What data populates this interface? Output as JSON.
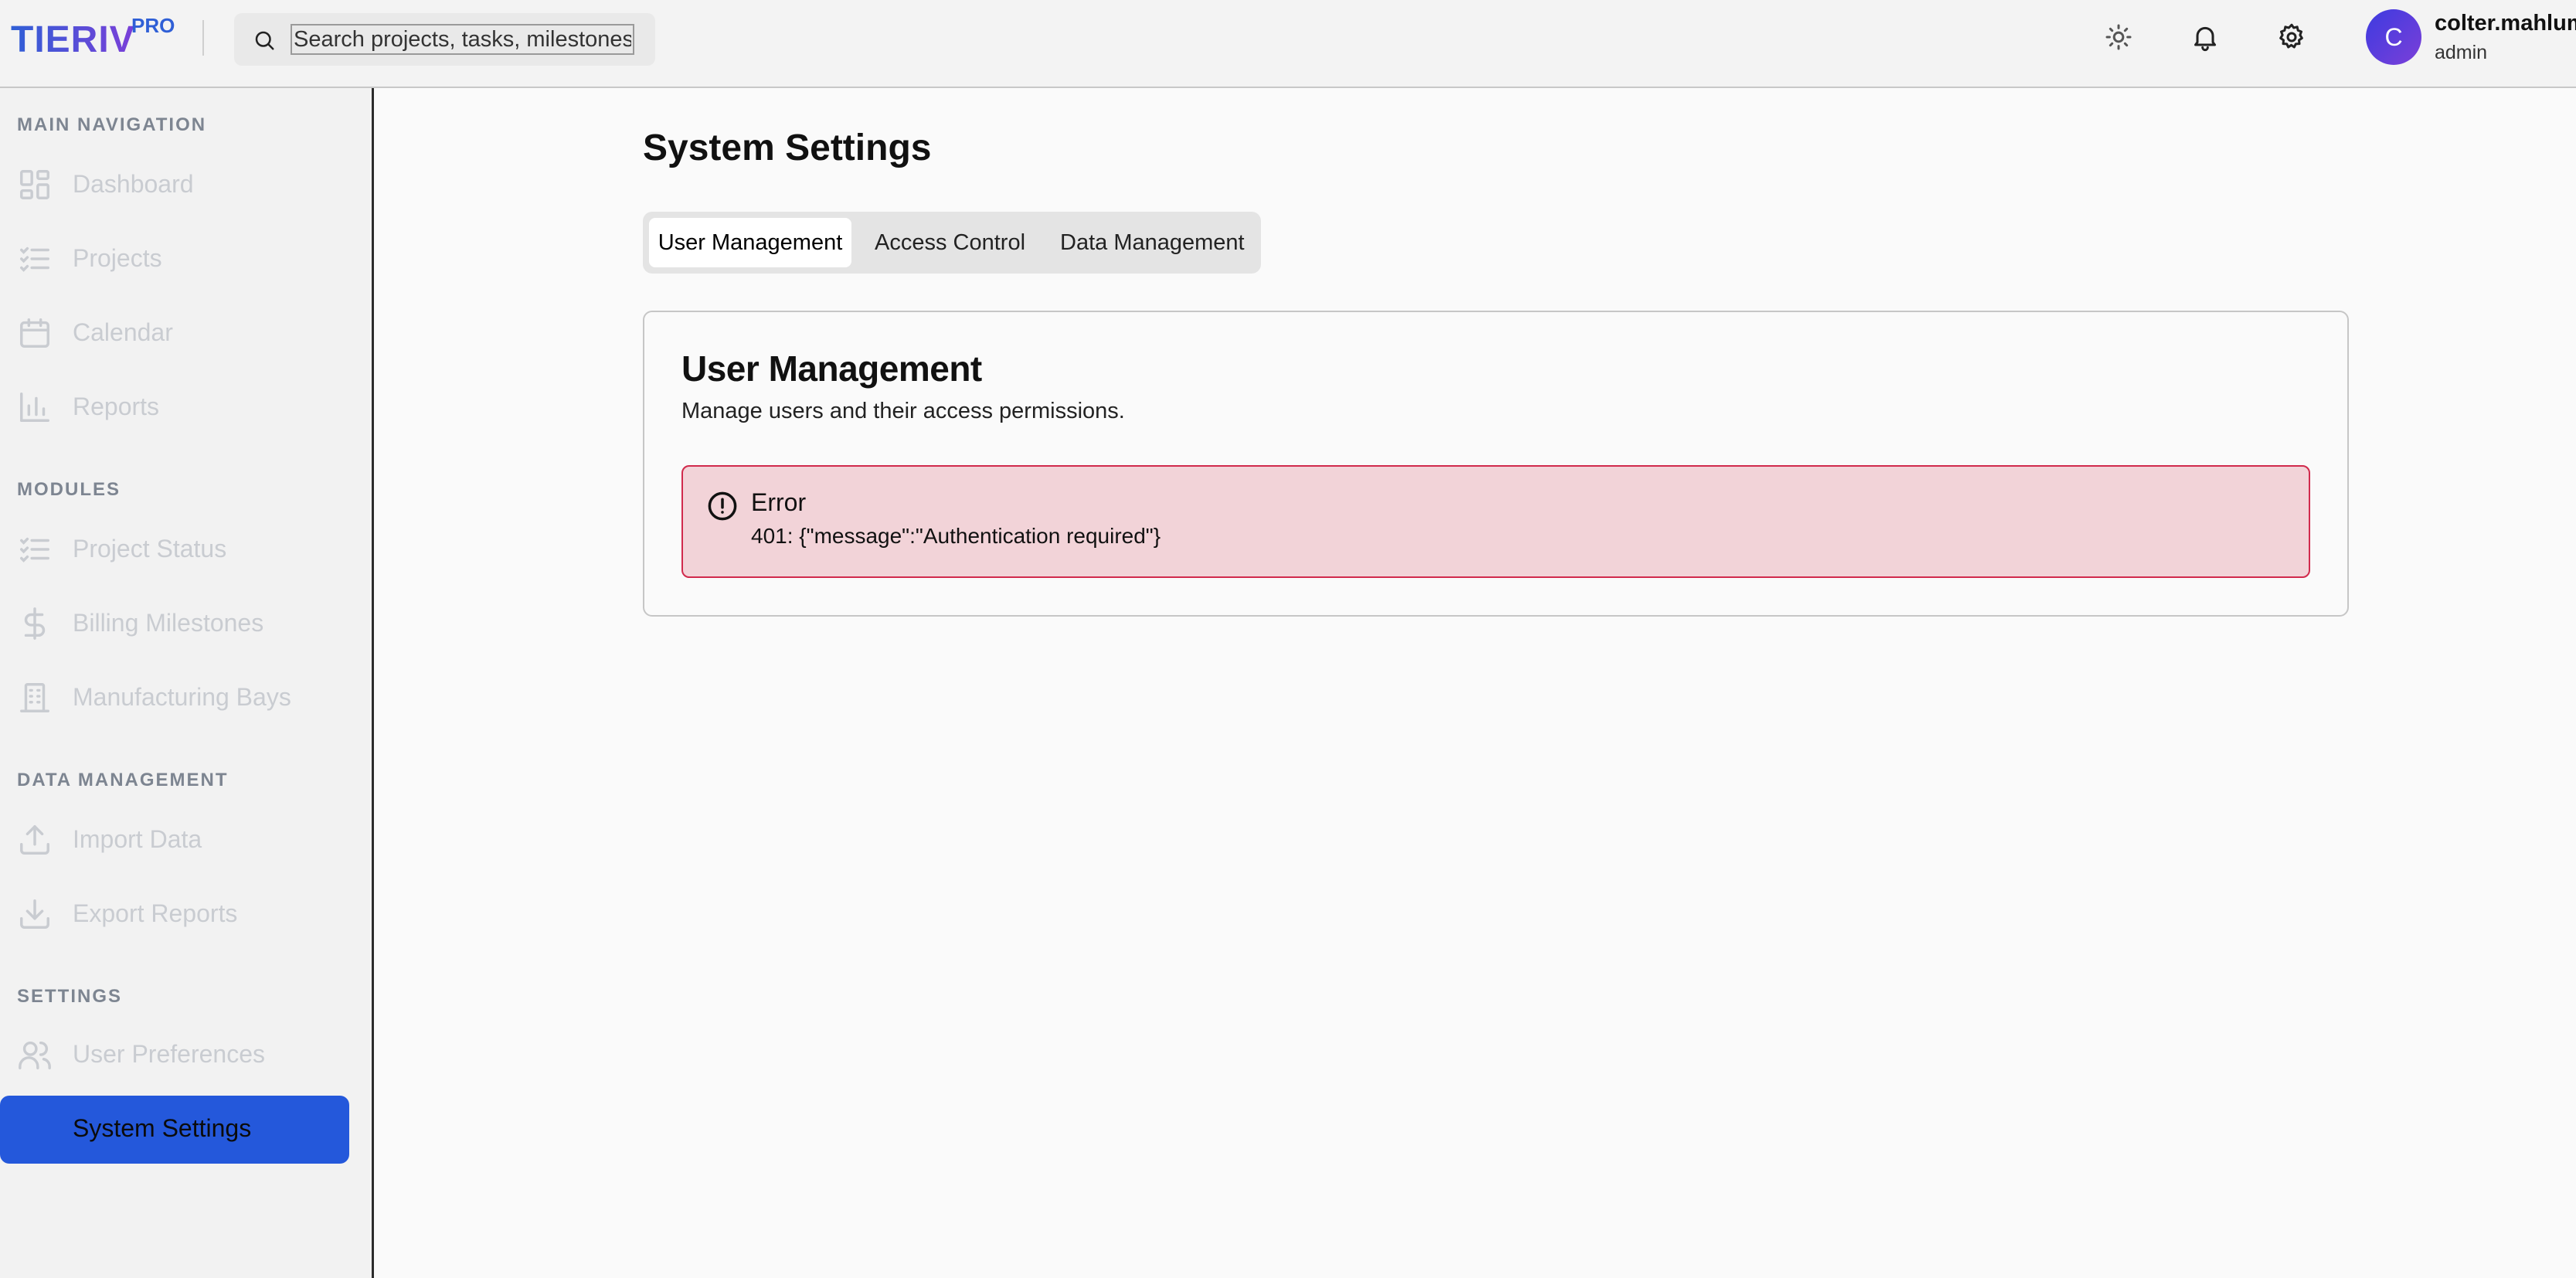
{
  "header": {
    "logo_main": "TIERIV",
    "logo_sup": "PRO",
    "search_placeholder": "Search projects, tasks, milestones",
    "icons": [
      "sun-icon",
      "bell-icon",
      "gear-icon"
    ],
    "user": {
      "initial": "C",
      "name": "colter.mahlum",
      "role": "admin"
    }
  },
  "sidebar": {
    "sections": [
      {
        "title": "MAIN NAVIGATION",
        "items": [
          {
            "label": "Dashboard",
            "icon": "dashboard-icon"
          },
          {
            "label": "Projects",
            "icon": "list-check-icon"
          },
          {
            "label": "Calendar",
            "icon": "calendar-icon"
          },
          {
            "label": "Reports",
            "icon": "bar-chart-icon"
          }
        ]
      },
      {
        "title": "MODULES",
        "items": [
          {
            "label": "Project Status",
            "icon": "list-check-icon"
          },
          {
            "label": "Billing Milestones",
            "icon": "dollar-icon"
          },
          {
            "label": "Manufacturing Bays",
            "icon": "building-icon"
          }
        ]
      },
      {
        "title": "DATA MANAGEMENT",
        "items": [
          {
            "label": "Import Data",
            "icon": "upload-icon"
          },
          {
            "label": "Export Reports",
            "icon": "download-icon"
          }
        ]
      },
      {
        "title": "SETTINGS",
        "items": [
          {
            "label": "User Preferences",
            "icon": "users-icon"
          },
          {
            "label": "System Settings",
            "active": true
          }
        ]
      }
    ]
  },
  "main": {
    "title": "System Settings",
    "tabs": [
      {
        "label": "User Management",
        "active": true
      },
      {
        "label": "Access Control"
      },
      {
        "label": "Data Management"
      }
    ],
    "card": {
      "title": "User Management",
      "description": "Manage users and their access permissions.",
      "alert": {
        "title": "Error",
        "message": "401: {\"message\":\"Authentication required\"}",
        "color": "#d12a4c"
      }
    }
  },
  "colors": {
    "accent": "#2458db",
    "brand_gradient_start": "#2f5fd6",
    "brand_gradient_end": "#7b3fd8"
  }
}
